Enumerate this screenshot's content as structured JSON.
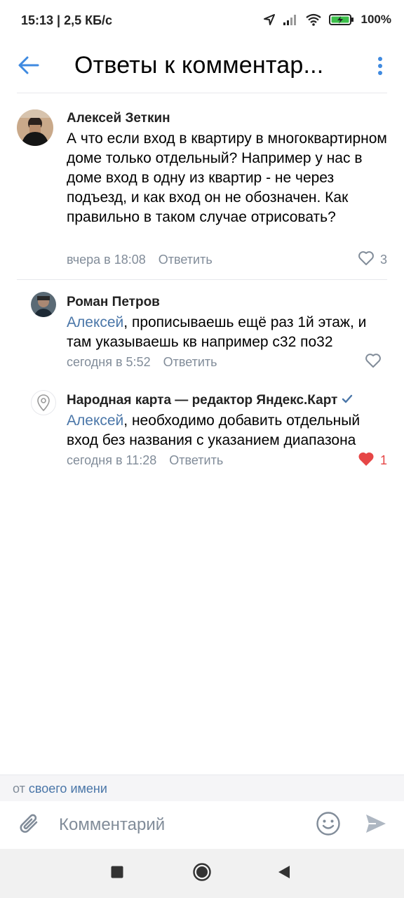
{
  "status_bar": {
    "time_speed": "15:13 | 2,5 КБ/с",
    "battery": "100%",
    "icons": [
      "location-arrow-icon",
      "signal-icon",
      "wifi-icon",
      "battery-charging-icon"
    ]
  },
  "header": {
    "title": "Ответы к комментар...",
    "back_icon": "arrow-left-icon",
    "more_icon": "more-vertical-icon"
  },
  "comments": [
    {
      "author": "Алексей Зеткин",
      "mention": "",
      "text": "А что если вход в квартиру в многоквартирном доме только отдельный? Например у нас в доме вход в одну из квартир - не через подъезд, и как вход он не обозначен. Как правильно в таком случае отрисовать?",
      "time": "вчера в 18:08",
      "reply_label": "Ответить",
      "likes": "3",
      "liked": false
    },
    {
      "author": "Роман Петров",
      "mention": "Алексей",
      "text": ", прописываешь ещё раз 1й этаж, и там указываешь кв например с32 по32",
      "time": "сегодня в 5:52",
      "reply_label": "Ответить",
      "likes": "",
      "liked": false
    },
    {
      "author": "Народная карта — редактор Яндекс.Карт",
      "verified": true,
      "mention": "Алексей",
      "text": ", необходимо добавить отдельный вход без названия с указанием диапазона",
      "time": "сегодня в 11:28",
      "reply_label": "Ответить",
      "likes": "1",
      "liked": true
    }
  ],
  "composer": {
    "from_prefix": "от",
    "from_link": "своего имени",
    "placeholder": "Комментарий",
    "icons": [
      "paperclip-icon",
      "emoji-icon",
      "send-icon"
    ]
  },
  "colors": {
    "accent": "#4a76a8",
    "header_icon": "#3f8ae0",
    "secondary_text": "#818c99",
    "like_red": "#e64646"
  }
}
